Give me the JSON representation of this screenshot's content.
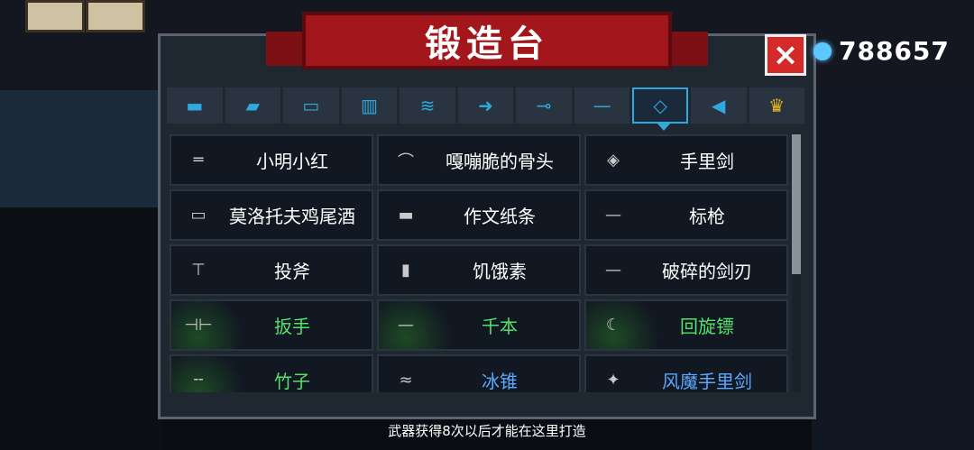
{
  "title": "锻造台",
  "currency": {
    "value": "788657",
    "icon": "gem-icon"
  },
  "close_icon": "×",
  "tabs": [
    {
      "icon": "pistol-icon",
      "glyph": "▬"
    },
    {
      "icon": "rifle-icon",
      "glyph": "▰"
    },
    {
      "icon": "shotgun-icon",
      "glyph": "▭"
    },
    {
      "icon": "launcher-icon",
      "glyph": "▥"
    },
    {
      "icon": "laser-icon",
      "glyph": "≋"
    },
    {
      "icon": "bow-icon",
      "glyph": "➜"
    },
    {
      "icon": "sword-icon",
      "glyph": "⊸"
    },
    {
      "icon": "spear-icon",
      "glyph": "—"
    },
    {
      "icon": "shuriken-icon",
      "glyph": "◇",
      "active": true
    },
    {
      "icon": "fish-icon",
      "glyph": "◀"
    },
    {
      "icon": "crown-icon",
      "glyph": "♛",
      "gold": true
    }
  ],
  "items": [
    {
      "label": "小明小红",
      "icon": "knives-icon",
      "glyph": "═",
      "color": "white"
    },
    {
      "label": "嘎嘣脆的骨头",
      "icon": "bone-icon",
      "glyph": "⌒",
      "color": "white"
    },
    {
      "label": "手里剑",
      "icon": "shuriken-icon",
      "glyph": "◈",
      "color": "white"
    },
    {
      "label": "莫洛托夫鸡尾酒",
      "icon": "molotov-icon",
      "glyph": "▭",
      "color": "white"
    },
    {
      "label": "作文纸条",
      "icon": "paper-icon",
      "glyph": "▬",
      "color": "white"
    },
    {
      "label": "标枪",
      "icon": "javelin-icon",
      "glyph": "—",
      "color": "white"
    },
    {
      "label": "投斧",
      "icon": "axe-icon",
      "glyph": "⊤",
      "color": "white"
    },
    {
      "label": "饥饿素",
      "icon": "syringe-icon",
      "glyph": "▮",
      "color": "white"
    },
    {
      "label": "破碎的剑刃",
      "icon": "blade-icon",
      "glyph": "—",
      "color": "white"
    },
    {
      "label": "扳手",
      "icon": "wrench-icon",
      "glyph": "⊣⊢",
      "color": "green"
    },
    {
      "label": "千本",
      "icon": "needle-icon",
      "glyph": "—",
      "color": "green"
    },
    {
      "label": "回旋镖",
      "icon": "boomerang-icon",
      "glyph": "☾",
      "color": "green"
    },
    {
      "label": "竹子",
      "icon": "bamboo-icon",
      "glyph": "╌",
      "color": "green"
    },
    {
      "label": "冰锥",
      "icon": "icicle-icon",
      "glyph": "≈",
      "color": "blue"
    },
    {
      "label": "风魔手里剑",
      "icon": "fuma-shuriken-icon",
      "glyph": "✦",
      "color": "blue"
    }
  ],
  "footer": "武器获得8次以后才能在这里打造",
  "colors": {
    "accent": "#2fa8e0",
    "banner": "#a3171c",
    "close": "#d42a2a",
    "green": "#55e06a",
    "blue": "#5aa8ff"
  }
}
